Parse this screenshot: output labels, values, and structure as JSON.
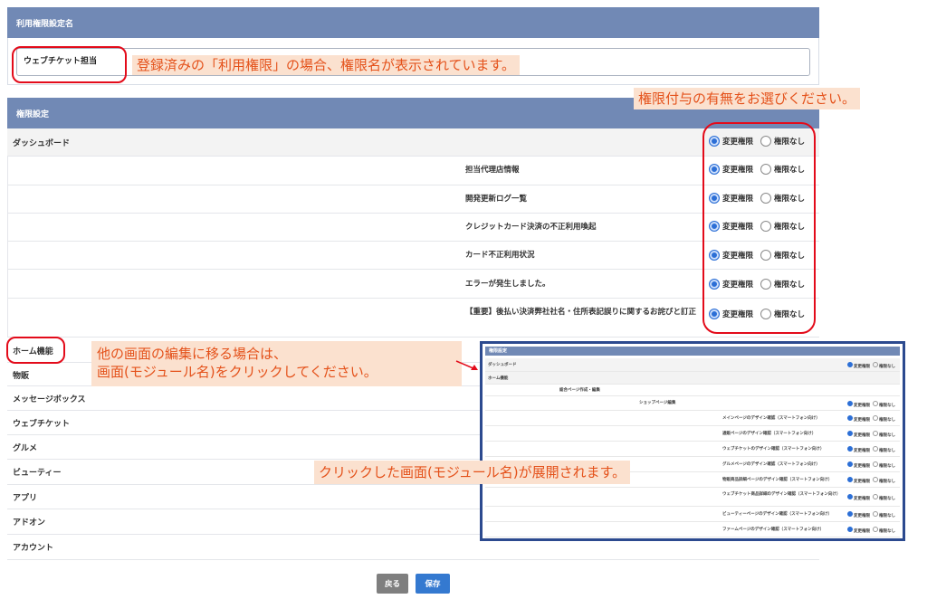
{
  "name_section": {
    "header": "利用権限設定名",
    "value": "ウェブチケット担当"
  },
  "permission_section": {
    "header": "権限設定",
    "option_change": "変更権限",
    "option_none": "権限なし"
  },
  "dashboard": {
    "label": "ダッシュボード",
    "items": [
      {
        "label": "担当代理店情報"
      },
      {
        "label": "開発更新ログ一覧"
      },
      {
        "label": "クレジットカード決済の不正利用喚起"
      },
      {
        "label": "カード不正利用状況"
      },
      {
        "label": "エラーが発生しました。"
      },
      {
        "label": "【重要】後払い決済弊社社名・住所表記誤りに関するお詫びと訂正"
      }
    ]
  },
  "modules": [
    {
      "label": "ホーム機能"
    },
    {
      "label": "物販"
    },
    {
      "label": "メッセージボックス"
    },
    {
      "label": "ウェブチケット"
    },
    {
      "label": "グルメ"
    },
    {
      "label": "ビューティー"
    },
    {
      "label": "アプリ"
    },
    {
      "label": "アドオン"
    },
    {
      "label": "アカウント"
    }
  ],
  "callouts": {
    "name": "登録済みの「利用権限」の場合、権限名が表示されています。",
    "choose": "権限付与の有無をお選びください。",
    "edit_line1": "他の画面の編集に移る場合は、",
    "edit_line2": "画面(モジュール名)をクリックしてください。",
    "expand": "クリックした画面(モジュール名)が展開されます。"
  },
  "buttons": {
    "back": "戻る",
    "save": "保存"
  },
  "inset": {
    "header": "権限設定",
    "dashboard": "ダッシュボード",
    "home": "ホーム機能",
    "page_edit": "総合ページ作成・編集",
    "shop_edit": "ショップページ編集",
    "option_change": "変更権限",
    "option_none": "権限なし",
    "items": [
      {
        "label": "メインページのデザイン確認（スマートフォン向け）"
      },
      {
        "label": "通販ページのデザイン確認（スマートフォン向け）"
      },
      {
        "label": "ウェブチケットのデザイン確認（スマートフォン向け）"
      },
      {
        "label": "グルメページのデザイン確認（スマートフォン向け）"
      },
      {
        "label": "物販商品詳細ページのデザイン確認（スマートフォン向け）"
      },
      {
        "label": "ウェブチケット商品詳細のデザイン確認（スマートフォン向け）"
      },
      {
        "label": "ビューティーページのデザイン確認（スマートフォン向け）"
      },
      {
        "label": "ファームページのデザイン確認（スマートフォン向け）"
      }
    ]
  },
  "colors": {
    "header": "#7189b5",
    "accent": "#2c6fd6",
    "annotation_red": "#e30b1a",
    "callout_bg": "#fbe1cf",
    "callout_text": "#e4511a",
    "inset_border": "#2c4a8f"
  }
}
